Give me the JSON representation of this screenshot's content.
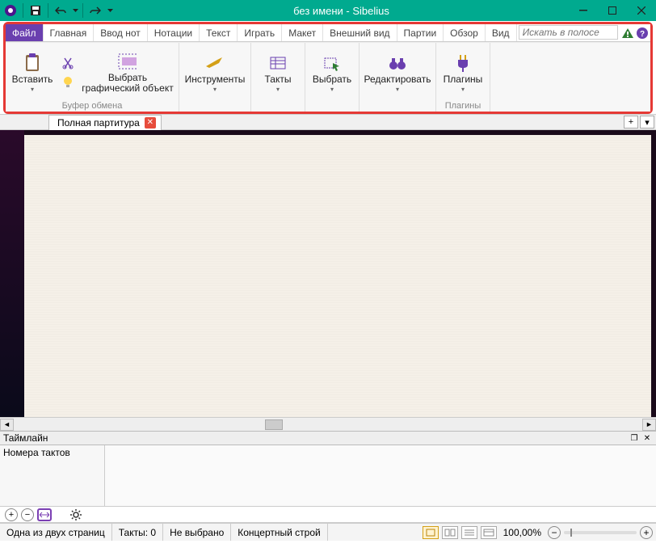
{
  "title": "без имени - Sibelius",
  "tabs": {
    "file": "Файл",
    "home": "Главная",
    "noteinput": "Ввод нот",
    "notations": "Нотации",
    "text": "Текст",
    "play": "Играть",
    "layout": "Макет",
    "appearance": "Внешний вид",
    "parts": "Партии",
    "review": "Обзор",
    "view": "Вид"
  },
  "search": {
    "placeholder": "Искать в полосе"
  },
  "ribbon": {
    "paste": {
      "label": "Вставить"
    },
    "select_graphic": {
      "label": "Выбрать графический объект"
    },
    "clipboard_group": "Буфер обмена",
    "instruments": {
      "label": "Инструменты"
    },
    "bars": {
      "label": "Такты"
    },
    "select": {
      "label": "Выбрать"
    },
    "edit": {
      "label": "Редактировать"
    },
    "plugins": {
      "label": "Плагины",
      "group": "Плагины"
    }
  },
  "doc_tab": "Полная партитура",
  "timeline": {
    "title": "Таймлайн",
    "row_label": "Номера тактов"
  },
  "status": {
    "pages": "Одна из двух страниц",
    "bars": "Такты: 0",
    "selection": "Не выбрано",
    "pitch": "Концертный строй",
    "zoom": "100,00%"
  }
}
